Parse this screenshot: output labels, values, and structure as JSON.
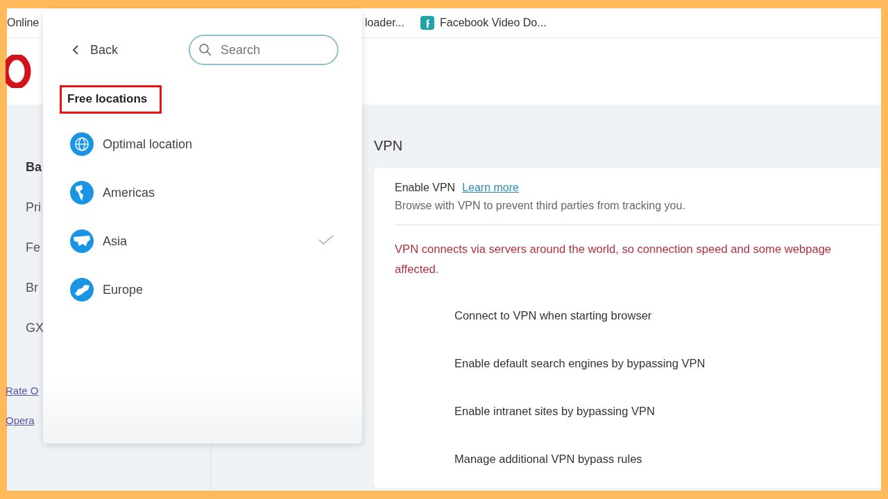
{
  "bookmarks": [
    {
      "label": "Online",
      "icon": false
    },
    {
      "label": "loader...",
      "icon": false
    },
    {
      "label": "Facebook Video Do...",
      "icon": true
    }
  ],
  "sidebar": {
    "items": [
      {
        "label": "Ba",
        "selected": true
      },
      {
        "label": "Pri",
        "selected": false
      },
      {
        "label": "Fe",
        "selected": false
      },
      {
        "label": "Br",
        "selected": false
      },
      {
        "label": "GX",
        "selected": false
      }
    ],
    "links": [
      "Rate O",
      "Opera"
    ]
  },
  "vpn": {
    "heading": "VPN",
    "enable_label": "Enable VPN",
    "learn_more": "Learn more",
    "description": "Browse with VPN to prevent third parties from tracking you.",
    "warning_lines": [
      "VPN connects via servers around the world, so connection speed and some webpage",
      "affected."
    ],
    "options": [
      "Connect to VPN when starting browser",
      "Enable default search engines by bypassing VPN",
      "Enable intranet sites by bypassing VPN",
      "Manage additional VPN bypass rules"
    ]
  },
  "location_popup": {
    "back": "Back",
    "search": {
      "placeholder": "Search"
    },
    "section": {
      "label": "Free locations",
      "highlighted": true
    },
    "locations": [
      {
        "label": "Optimal location",
        "kind": "globe",
        "selected": false
      },
      {
        "label": "Americas",
        "kind": "americas",
        "selected": false
      },
      {
        "label": "Asia",
        "kind": "asia",
        "selected": true
      },
      {
        "label": "Europe",
        "kind": "europe",
        "selected": false
      }
    ]
  }
}
